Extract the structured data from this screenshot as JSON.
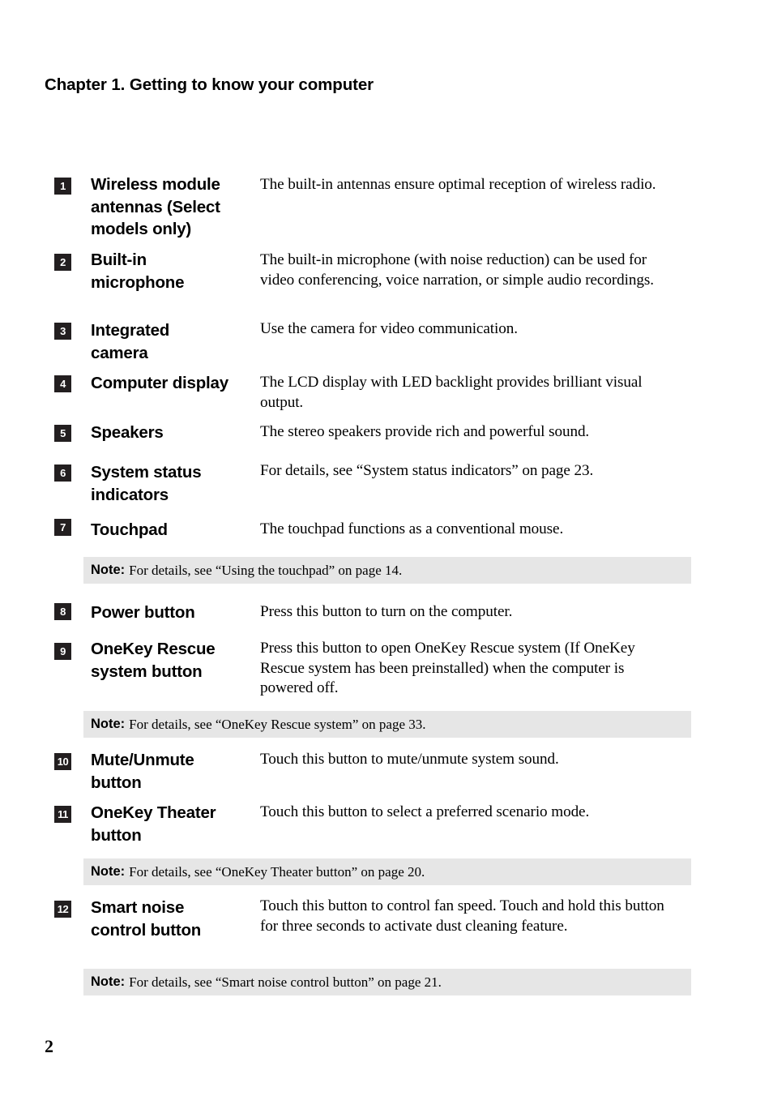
{
  "header": {
    "chapter_title": "Chapter 1. Getting to know your computer"
  },
  "items": [
    {
      "number": "1",
      "label": "Wireless module antennas (Select models only)",
      "description": "The built-in antennas ensure optimal reception of wireless radio."
    },
    {
      "number": "2",
      "label": "Built-in microphone",
      "description": "The built-in microphone (with noise reduction) can be used for video conferencing, voice narration, or simple audio recordings."
    },
    {
      "number": "3",
      "label": "Integrated camera",
      "description": "Use the camera for video communication."
    },
    {
      "number": "4",
      "label": "Computer display",
      "description": "The LCD display with LED backlight provides brilliant visual output."
    },
    {
      "number": "5",
      "label": "Speakers",
      "description": "The stereo speakers provide rich and powerful sound."
    },
    {
      "number": "6",
      "label": "System status indicators",
      "description": "For details, see “System status indicators” on page 23."
    },
    {
      "number": "7",
      "label": "Touchpad",
      "description": "The touchpad functions as a conventional mouse."
    },
    {
      "number": "8",
      "label": "Power button",
      "description": "Press this button to turn on the computer."
    },
    {
      "number": "9",
      "label": "OneKey Rescue system button",
      "description": "Press this button to open OneKey Rescue system (If OneKey Rescue system has been preinstalled) when the computer is powered off."
    },
    {
      "number": "10",
      "label": "Mute/Unmute button",
      "description": "Touch this button to mute/unmute system sound."
    },
    {
      "number": "11",
      "label": "OneKey Theater button",
      "description": "Touch this button to select a preferred scenario mode."
    },
    {
      "number": "12",
      "label": "Smart noise control button",
      "description": "Touch this button to control fan speed. Touch and hold this button for three seconds to activate dust cleaning feature."
    }
  ],
  "notes": [
    {
      "label": "Note:",
      "text": "For details, see “Using the touchpad” on page 14."
    },
    {
      "label": "Note:",
      "text": "For details, see “OneKey Rescue system” on page 33."
    },
    {
      "label": "Note:",
      "text": "For details, see “OneKey Theater button” on page 20."
    },
    {
      "label": "Note:",
      "text": "For details, see “Smart noise control button” on page 21."
    }
  ],
  "footer": {
    "page_number": "2"
  }
}
